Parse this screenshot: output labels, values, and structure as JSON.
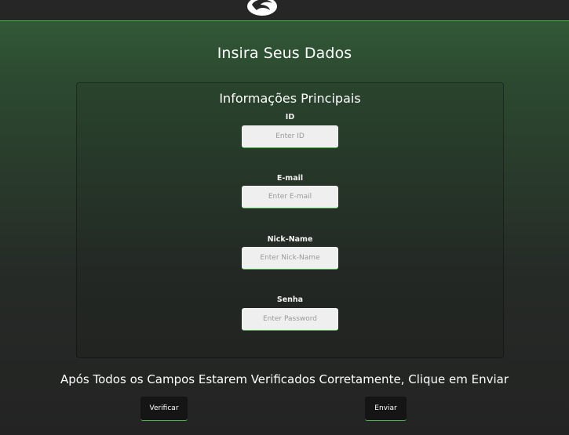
{
  "header": {
    "logo_icon": "dragon-logo-icon",
    "accent_color": "#4caf50"
  },
  "page": {
    "title": "Insira Seus Dados"
  },
  "form": {
    "section_title": "Informações Principais",
    "fields": [
      {
        "label": "ID",
        "placeholder": "Enter ID",
        "value": ""
      },
      {
        "label": "E-mail",
        "placeholder": "Enter E-mail",
        "value": ""
      },
      {
        "label": "Nick-Name",
        "placeholder": "Enter Nick-Name",
        "value": ""
      },
      {
        "label": "Senha",
        "placeholder": "Enter Password",
        "value": ""
      }
    ]
  },
  "footer": {
    "note": "Após Todos os Campos Estarem Verificados Corretamente, Clique em Enviar",
    "verify_label": "Verificar",
    "send_label": "Enviar"
  }
}
